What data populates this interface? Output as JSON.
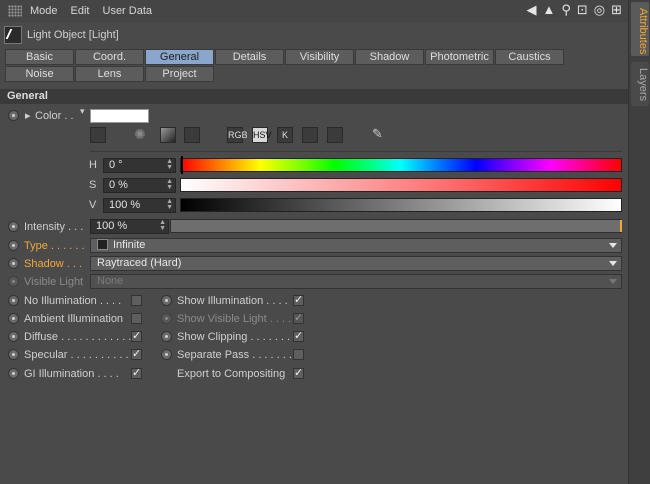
{
  "menu": {
    "items": [
      "Mode",
      "Edit",
      "User Data"
    ]
  },
  "side_tabs": {
    "active": "Attributes",
    "inactive": "Layers"
  },
  "object": {
    "title": "Light Object [Light]"
  },
  "tabs": {
    "row1": [
      "Basic",
      "Coord.",
      "General",
      "Details",
      "Visibility",
      "Shadow",
      "Photometric",
      "Caustics"
    ],
    "row2": [
      "Noise",
      "Lens",
      "Project"
    ],
    "active": "General"
  },
  "section": {
    "title": "General"
  },
  "color": {
    "label": "Color . .",
    "swatch": "#ffffff",
    "mode_buttons": [
      "RGB",
      "HSV",
      "K"
    ],
    "active_mode": "HSV",
    "h_label": "H",
    "h_value": "0 °",
    "s_label": "S",
    "s_value": "0 %",
    "v_label": "V",
    "v_value": "100 %"
  },
  "intensity": {
    "label": "Intensity . . .",
    "value": "100 %",
    "level": 1.0
  },
  "type": {
    "label": "Type . . . . . .",
    "value": "Infinite"
  },
  "shadow": {
    "label": "Shadow . . .",
    "value": "Raytraced (Hard)"
  },
  "visible_light": {
    "label": "Visible Light",
    "value": "None"
  },
  "checkboxes_left": [
    {
      "label": "No Illumination . . . .",
      "checked": false
    },
    {
      "label": "Ambient Illumination",
      "checked": false
    },
    {
      "label": "Diffuse . . . . . . . . . . . .",
      "checked": true
    },
    {
      "label": "Specular . . . . . . . . . .",
      "checked": true
    },
    {
      "label": "GI Illumination . . . .",
      "checked": true
    }
  ],
  "checkboxes_right": [
    {
      "label": "Show Illumination . . . .",
      "checked": true
    },
    {
      "label": "Show Visible Light . . . .",
      "checked": true
    },
    {
      "label": "Show Clipping . . . . . . .",
      "checked": true
    },
    {
      "label": "Separate Pass . . . . . . .",
      "checked": false
    },
    {
      "label": "Export to Compositing",
      "checked": true
    }
  ],
  "colors": {
    "accent": "#f0a83a",
    "active_tab": "#8aa6cc",
    "panel": "#4a4a4a"
  }
}
